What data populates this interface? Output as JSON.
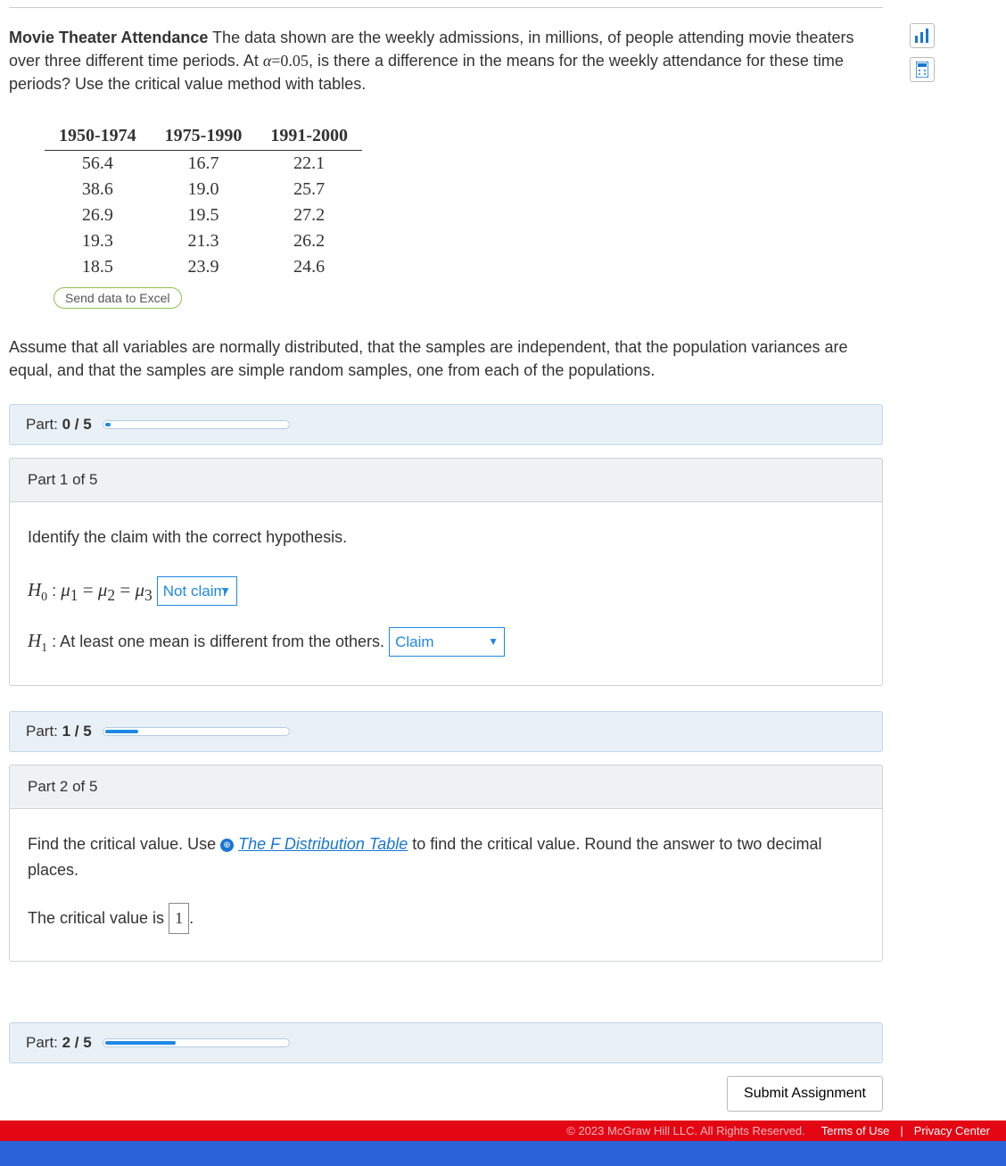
{
  "problem": {
    "title": "Movie Theater Attendance",
    "text_part1": " The data shown are the weekly admissions, in millions, of people attending movie theaters over three different time periods. At ",
    "alpha": "α",
    "alpha_val": "=0.05",
    "text_part2": ", is there a difference in the means for the weekly attendance for these time periods? Use the critical value method with tables."
  },
  "data_table": {
    "headers": [
      "1950-1974",
      "1975-1990",
      "1991-2000"
    ],
    "rows": [
      [
        "56.4",
        "16.7",
        "22.1"
      ],
      [
        "38.6",
        "19.0",
        "25.7"
      ],
      [
        "26.9",
        "19.5",
        "27.2"
      ],
      [
        "19.3",
        "21.3",
        "26.2"
      ],
      [
        "18.5",
        "23.9",
        "24.6"
      ]
    ]
  },
  "excel_btn": "Send data to Excel",
  "assumptions": "Assume that all variables are normally distributed, that the samples are independent, that the population variances are equal, and that the samples are simple random samples, one from each of the populations.",
  "progress0": {
    "label_prefix": "Part: ",
    "bold": "0 / 5",
    "fill_pct": 3
  },
  "part1": {
    "header": "Part 1 of 5",
    "instruction": "Identify the claim with the correct hypothesis.",
    "h0_prefix": "H",
    "h0_sub": "0",
    "h0_sep": " : ",
    "h0_math": "μ₁ = μ₂ = μ₃",
    "h0_select": "Not claim",
    "h1_prefix": "H",
    "h1_sub": "1",
    "h1_text": " : At least one mean is different from the others.",
    "h1_select": "Claim"
  },
  "progress1": {
    "label_prefix": "Part: ",
    "bold": "1 / 5",
    "fill_pct": 18
  },
  "part2": {
    "header": "Part 2 of 5",
    "text_before": "Find the critical value. Use ",
    "link_text": "The F Distribution Table",
    "text_after": " to find the critical value. Round the answer to two decimal places.",
    "cv_label": "The critical value is ",
    "cv_value": "1",
    "cv_period": "."
  },
  "progress2": {
    "label_prefix": "Part: ",
    "bold": "2 / 5",
    "fill_pct": 38
  },
  "submit": "Submit Assignment",
  "footer": {
    "copy": "© 2023 McGraw Hill LLC. All Rights Reserved.",
    "terms": "Terms of Use",
    "sep": " | ",
    "privacy": "Privacy Center"
  }
}
